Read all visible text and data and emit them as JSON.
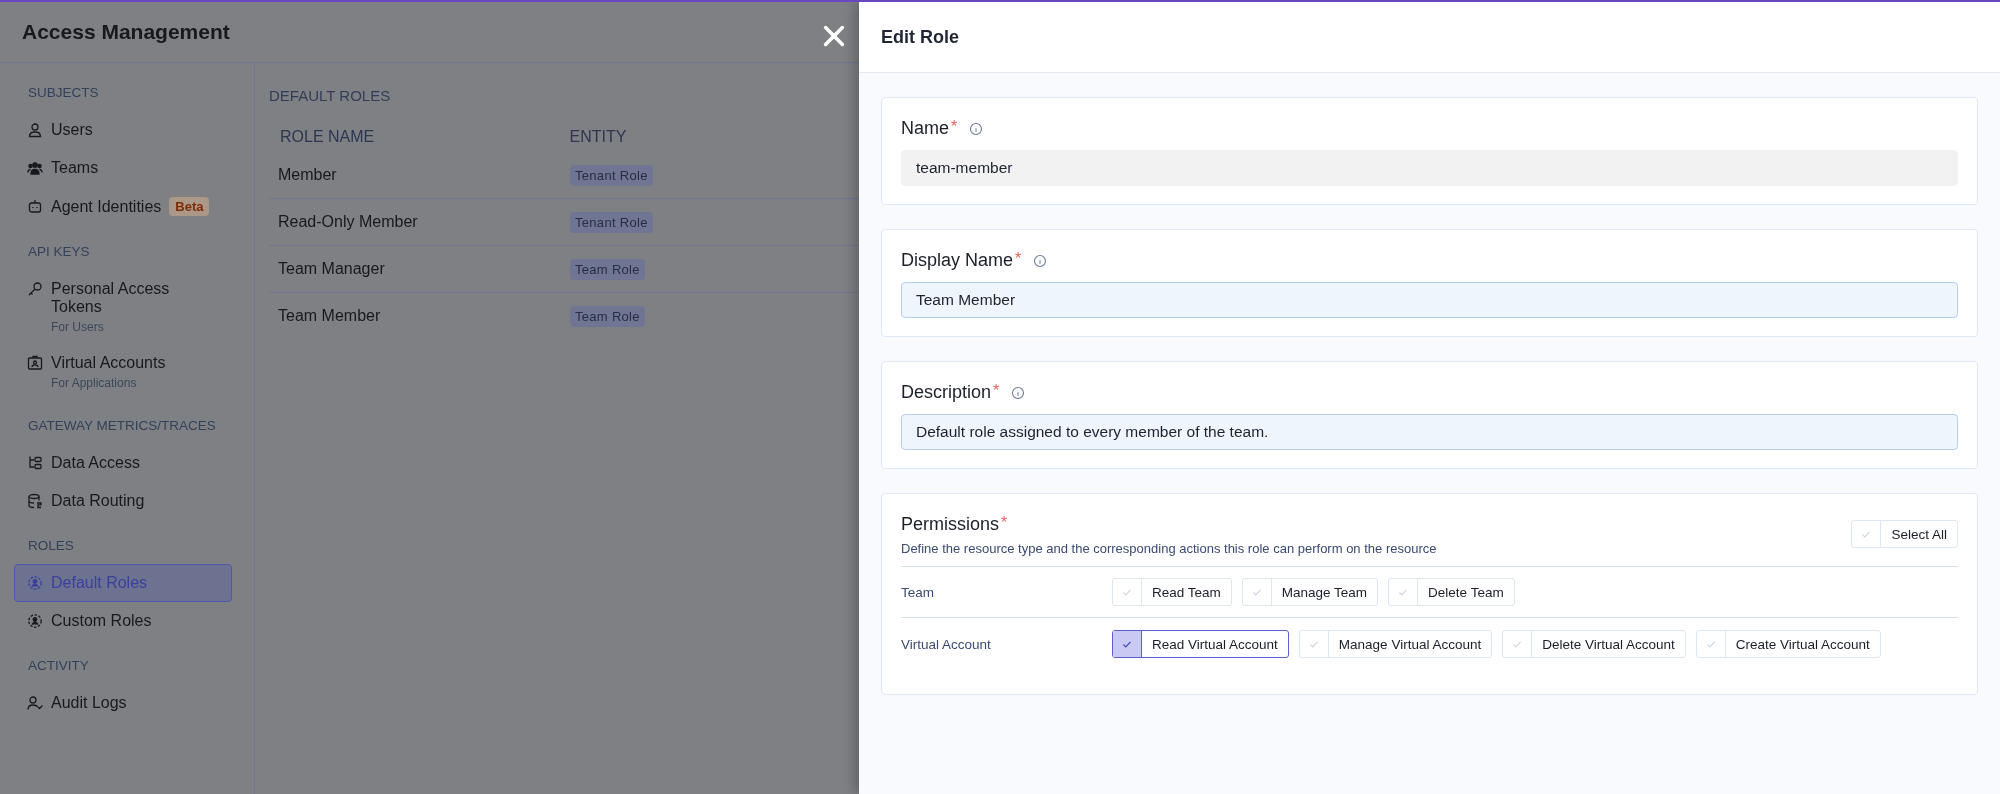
{
  "app": {
    "title": "Access Management"
  },
  "sidebar": {
    "sections": [
      {
        "heading": "SUBJECTS",
        "items": [
          {
            "label": "Users",
            "selected": false
          },
          {
            "label": "Teams",
            "selected": false
          },
          {
            "label": "Agent Identities",
            "badge": "Beta",
            "selected": false
          }
        ]
      },
      {
        "heading": "API KEYS",
        "items": [
          {
            "label": "Personal Access Tokens",
            "subtitle": "For Users",
            "selected": false
          },
          {
            "label": "Virtual Accounts",
            "subtitle": "For Applications",
            "selected": false
          }
        ]
      },
      {
        "heading": "GATEWAY METRICS/TRACES",
        "items": [
          {
            "label": "Data Access",
            "selected": false
          },
          {
            "label": "Data Routing",
            "selected": false
          }
        ]
      },
      {
        "heading": "ROLES",
        "items": [
          {
            "label": "Default Roles",
            "selected": true
          },
          {
            "label": "Custom Roles",
            "selected": false
          }
        ]
      },
      {
        "heading": "ACTIVITY",
        "items": [
          {
            "label": "Audit Logs",
            "selected": false
          }
        ]
      }
    ]
  },
  "main": {
    "heading": "DEFAULT ROLES",
    "table": {
      "columns": [
        "ROLE NAME",
        "ENTITY"
      ],
      "rows": [
        {
          "role_name": "Member",
          "entity": "Tenant Role"
        },
        {
          "role_name": "Read-Only Member",
          "entity": "Tenant Role"
        },
        {
          "role_name": "Team Manager",
          "entity": "Team Role"
        },
        {
          "role_name": "Team Member",
          "entity": "Team Role"
        }
      ]
    }
  },
  "drawer": {
    "title": "Edit Role",
    "fields": [
      {
        "label": "Name",
        "required_mark": "*",
        "value": "team-member",
        "disabled": true
      },
      {
        "label": "Display Name",
        "required_mark": "*",
        "value": "Team Member",
        "disabled": false
      },
      {
        "label": "Description",
        "required_mark": "*",
        "value": "Default role assigned to every member of the team.",
        "disabled": false
      }
    ],
    "permissions": {
      "label": "Permissions",
      "required_mark": "*",
      "description": "Define the resource type and the corresponding actions this role can perform on the resource",
      "select_all": {
        "label": "Select All",
        "checked": false
      },
      "resources": [
        {
          "name": "Team",
          "actions": [
            {
              "label": "Read Team",
              "checked": false
            },
            {
              "label": "Manage Team",
              "checked": false
            },
            {
              "label": "Delete Team",
              "checked": false
            }
          ]
        },
        {
          "name": "Virtual Account",
          "actions": [
            {
              "label": "Read Virtual Account",
              "checked": true
            },
            {
              "label": "Manage Virtual Account",
              "checked": false
            },
            {
              "label": "Delete Virtual Account",
              "checked": false
            },
            {
              "label": "Create Virtual Account",
              "checked": false
            }
          ]
        }
      ]
    }
  }
}
